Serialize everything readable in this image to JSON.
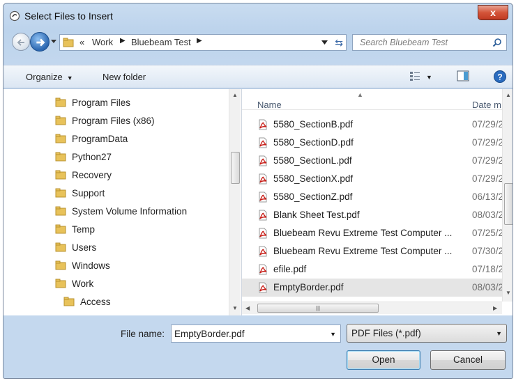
{
  "window": {
    "title": "Select Files to Insert",
    "close_label": "x"
  },
  "nav": {
    "breadcrumb_prefix": "«",
    "breadcrumbs": [
      "Work",
      "Bluebeam Test"
    ],
    "search_placeholder": "Search Bluebeam Test"
  },
  "toolbar": {
    "organize_label": "Organize",
    "new_folder_label": "New folder"
  },
  "folders": [
    {
      "label": "Program Files"
    },
    {
      "label": "Program Files (x86)"
    },
    {
      "label": "ProgramData"
    },
    {
      "label": "Python27"
    },
    {
      "label": "Recovery"
    },
    {
      "label": "Support"
    },
    {
      "label": "System Volume Information"
    },
    {
      "label": "Temp"
    },
    {
      "label": "Users"
    },
    {
      "label": "Windows"
    },
    {
      "label": "Work"
    },
    {
      "label": "Access"
    }
  ],
  "files": {
    "columns": {
      "name": "Name",
      "date": "Date m"
    },
    "rows": [
      {
        "name": "5580_SectionB.pdf",
        "date": "07/29/2"
      },
      {
        "name": "5580_SectionD.pdf",
        "date": "07/29/2"
      },
      {
        "name": "5580_SectionL.pdf",
        "date": "07/29/2"
      },
      {
        "name": "5580_SectionX.pdf",
        "date": "07/29/2"
      },
      {
        "name": "5580_SectionZ.pdf",
        "date": "06/13/2"
      },
      {
        "name": "Blank Sheet Test.pdf",
        "date": "08/03/2"
      },
      {
        "name": "Bluebeam Revu Extreme Test Computer ...",
        "date": "07/25/2"
      },
      {
        "name": "Bluebeam Revu Extreme Test Computer ...",
        "date": "07/30/2"
      },
      {
        "name": "efile.pdf",
        "date": "07/18/2"
      },
      {
        "name": "EmptyBorder.pdf",
        "date": "08/03/2",
        "selected": true
      }
    ]
  },
  "bottom": {
    "file_name_label": "File name:",
    "file_name_value": "EmptyBorder.pdf",
    "filter_value": "PDF Files (*.pdf)",
    "open_label": "Open",
    "cancel_label": "Cancel"
  },
  "colors": {
    "selection": "#e5e5e5",
    "pdf_red": "#c8201a",
    "folder_yellow": "#e8c25a"
  }
}
